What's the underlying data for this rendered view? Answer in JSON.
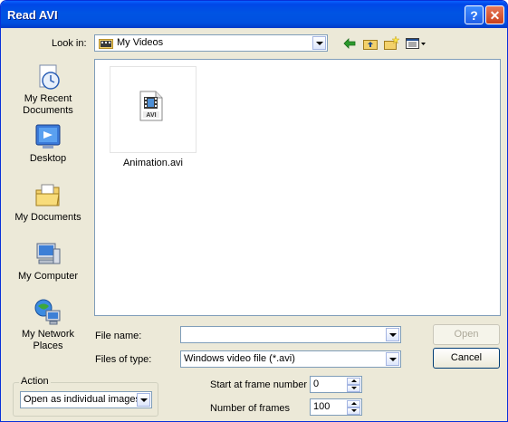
{
  "window": {
    "title": "Read AVI",
    "help_label": "?",
    "close_label": "✕"
  },
  "lookin": {
    "label": "Look in:",
    "value": "My Videos"
  },
  "places": [
    {
      "label": "My Recent Documents",
      "icon": "recent-documents-icon"
    },
    {
      "label": "Desktop",
      "icon": "desktop-icon"
    },
    {
      "label": "My Documents",
      "icon": "my-documents-icon"
    },
    {
      "label": "My Computer",
      "icon": "my-computer-icon"
    },
    {
      "label": "My Network Places",
      "icon": "network-places-icon"
    }
  ],
  "files": [
    {
      "name": "Animation.avi",
      "badge": "AVI"
    }
  ],
  "filename": {
    "label": "File name:",
    "value": ""
  },
  "filetype": {
    "label": "Files of type:",
    "value": "Windows video file (*.avi)"
  },
  "buttons": {
    "open": "Open",
    "cancel": "Cancel"
  },
  "action": {
    "label": "Action",
    "value": "Open as individual images"
  },
  "start_frame": {
    "label": "Start at frame number",
    "value": "0"
  },
  "num_frames": {
    "label": "Number of frames",
    "value": "100"
  }
}
